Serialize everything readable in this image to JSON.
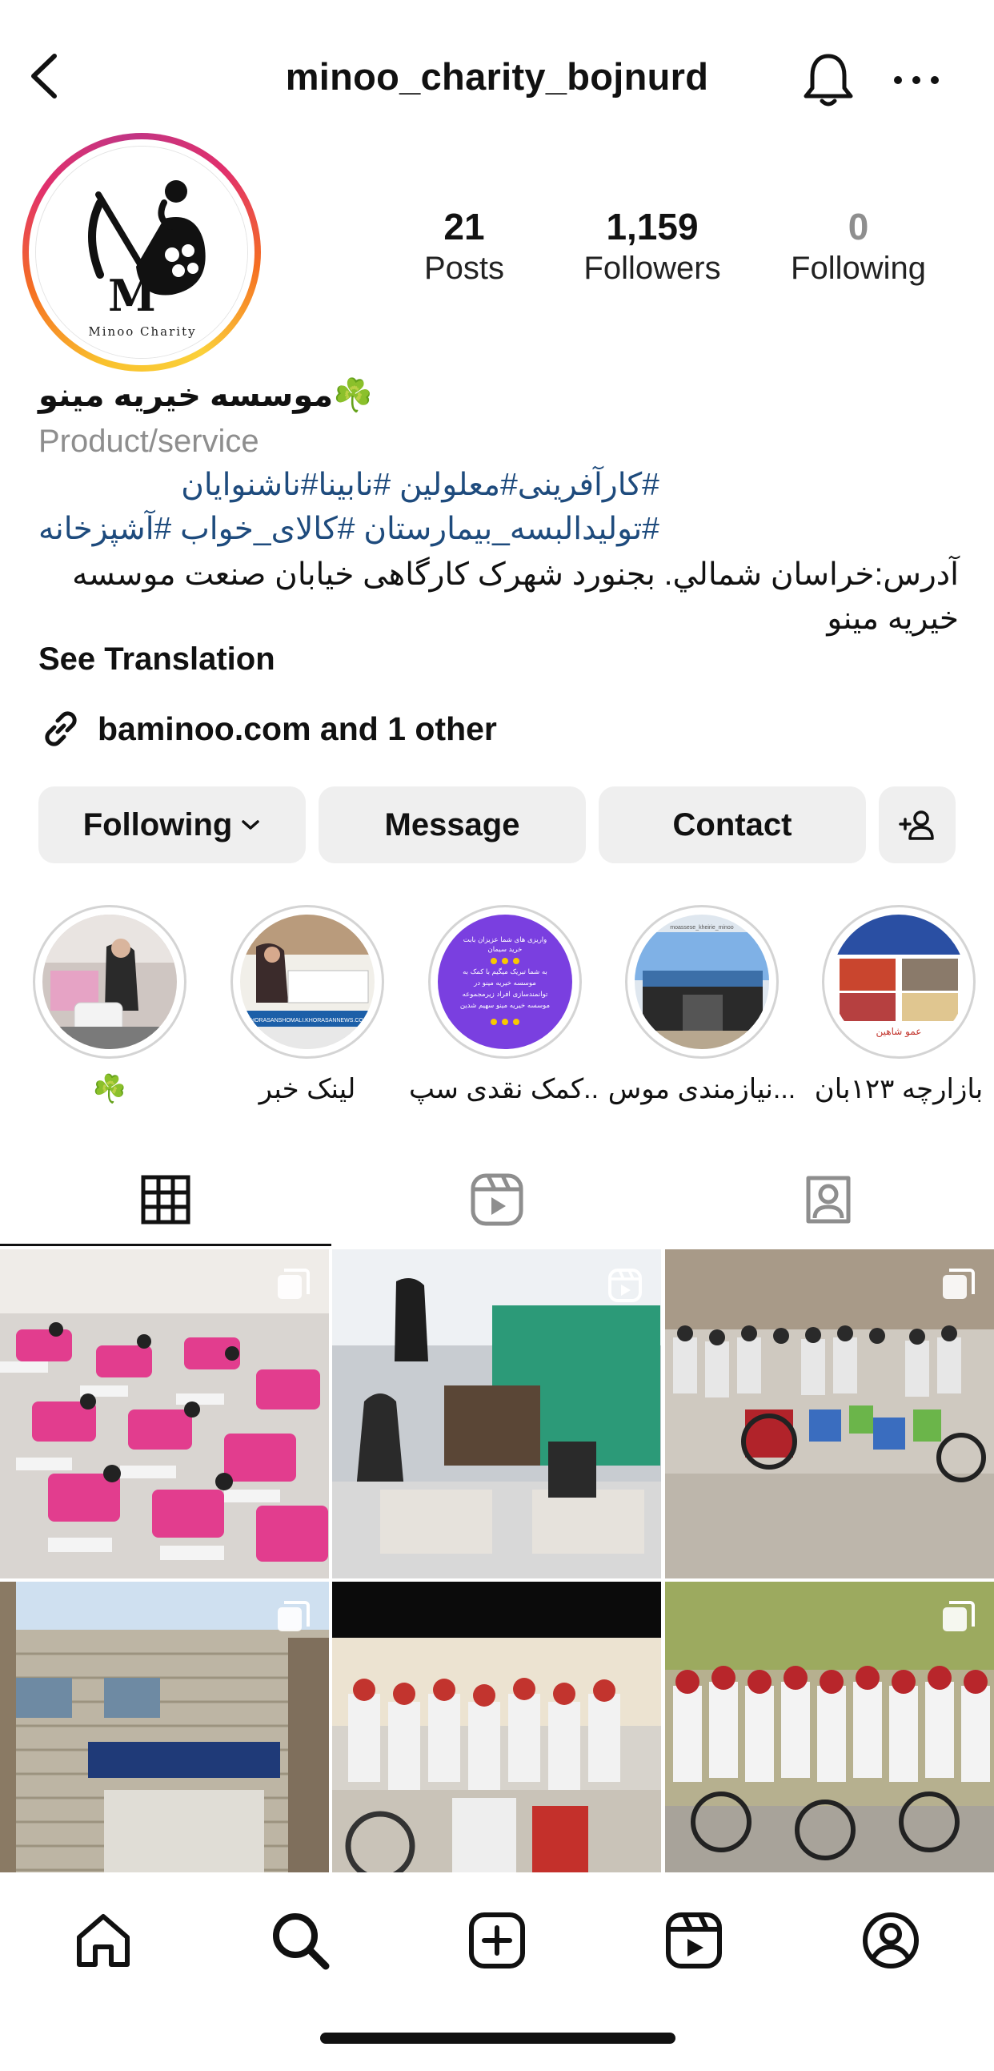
{
  "header": {
    "username": "minoo_charity_bojnurd"
  },
  "profile": {
    "avatar_caption": "Minoo Charity",
    "stats": {
      "posts_count": "21",
      "posts_label": "Posts",
      "followers_count": "1,159",
      "followers_label": "Followers",
      "following_count": "0",
      "following_label": "Following"
    },
    "name": "موسسه خیریه مینو☘️",
    "category": "Product/service",
    "hashtags_line1": "#کارآفرینی#معلولین #نابینا#ناشنوایان",
    "hashtags_line2": "#تولیدالبسه_بیمارستان #کالای_خواب #آشپزخانه",
    "address": "آدرس:خراسان شمالي. بجنورد شهرک کارگاهی خیابان صنعت موسسه خیریه مینو",
    "see_translation": "See Translation",
    "link": "baminoo.com and 1 other"
  },
  "actions": {
    "following": "Following",
    "message": "Message",
    "contact": "Contact"
  },
  "highlights": [
    {
      "label": "☘️"
    },
    {
      "label": "لینک خبر"
    },
    {
      "label": "کمک نقدی سپ..."
    },
    {
      "label": "نیازمندی موس..."
    },
    {
      "label": "بازارچه ۱۲۳بان"
    }
  ],
  "highlight_texts": {
    "story3_line1": "واریزی های شما عزیزان بابت",
    "story3_line2": "خرید سیمان",
    "story3_line3": "به شما تبریک میگیم با کمک به",
    "story3_line4": "موسسه خیریه مینو در",
    "story3_line5": "توانمندسازی افراد زیرمجموعه",
    "story3_line6": "موسسه خیریه مینو سهیم شدین",
    "story2_caption": "KHORASANSHOMALI.KHORASANNEWS.COM",
    "story4_caption": "moassese_kheirie_minoo",
    "story5_caption": "عمو شاهین"
  },
  "tabs": [
    {
      "name": "grid-icon",
      "active": true
    },
    {
      "name": "reels-icon",
      "active": false
    },
    {
      "name": "tagged-icon",
      "active": false
    }
  ],
  "grid_posts": [
    {
      "type": "carousel"
    },
    {
      "type": "reel"
    },
    {
      "type": "carousel"
    },
    {
      "type": "carousel"
    },
    {
      "type": "image"
    },
    {
      "type": "carousel"
    }
  ],
  "nav": [
    "home-icon",
    "search-icon",
    "create-icon",
    "reels-icon",
    "profile-icon"
  ],
  "colors": {
    "link_blue": "#1e4b7d",
    "button_bg": "#efefef",
    "muted_text": "#8e8e8e",
    "highlight_purple": "#7a3fe0"
  }
}
